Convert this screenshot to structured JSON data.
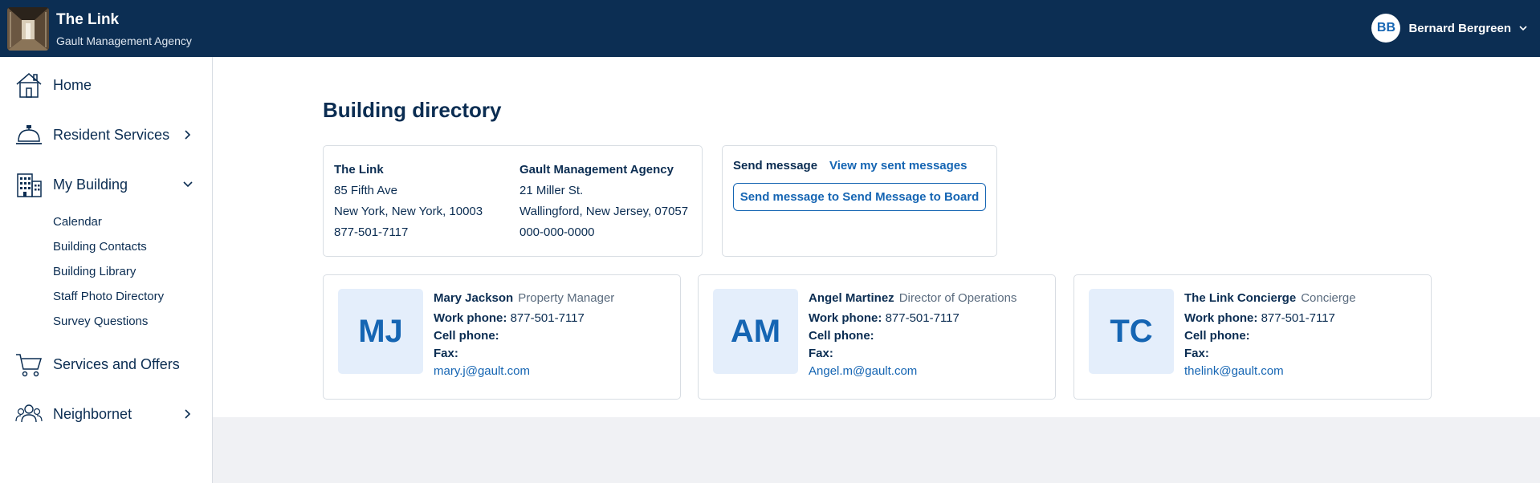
{
  "header": {
    "app_title": "The Link",
    "app_subtitle": "Gault Management Agency",
    "user_initials": "BB",
    "user_name": "Bernard Bergreen"
  },
  "sidebar": {
    "items": [
      {
        "label": "Home",
        "icon": "home-icon"
      },
      {
        "label": "Resident Services",
        "icon": "service-bell-icon"
      },
      {
        "label": "My Building",
        "icon": "building-icon"
      },
      {
        "label": "Services and Offers",
        "icon": "shopping-cart-icon"
      },
      {
        "label": "Neighbornet",
        "icon": "people-icon"
      }
    ],
    "my_building_children": [
      "Calendar",
      "Building Contacts",
      "Building Library",
      "Staff Photo Directory",
      "Survey Questions"
    ]
  },
  "main": {
    "title": "Building directory",
    "building": {
      "name": "The Link",
      "address1": "85 Fifth Ave",
      "address2": "New York, New York, 10003",
      "phone": "877-501-7117"
    },
    "agency": {
      "name": "Gault Management Agency",
      "address1": "21 Miller St.",
      "address2": "Wallingford, New Jersey, 07057",
      "phone": "000-000-0000"
    },
    "message": {
      "label": "Send message",
      "link": "View my sent messages",
      "button": "Send message to Send Message to Board"
    },
    "labels": {
      "work_phone": "Work phone:",
      "cell_phone": "Cell phone:",
      "fax": "Fax:"
    },
    "contacts": [
      {
        "initials": "MJ",
        "name": "Mary Jackson",
        "role": "Property Manager",
        "work_phone": "877-501-7117",
        "cell_phone": "",
        "fax": "",
        "email": "mary.j@gault.com"
      },
      {
        "initials": "AM",
        "name": "Angel Martinez",
        "role": "Director of Operations",
        "work_phone": "877-501-7117",
        "cell_phone": "",
        "fax": "",
        "email": "Angel.m@gault.com"
      },
      {
        "initials": "TC",
        "name": "The Link Concierge",
        "role": "Concierge",
        "work_phone": "877-501-7117",
        "cell_phone": "",
        "fax": "",
        "email": "thelink@gault.com"
      }
    ]
  },
  "colors": {
    "header_bg": "#0c2e53",
    "accent": "#1565b3",
    "text": "#0b2d52",
    "initials_bg": "#e4eefb"
  }
}
